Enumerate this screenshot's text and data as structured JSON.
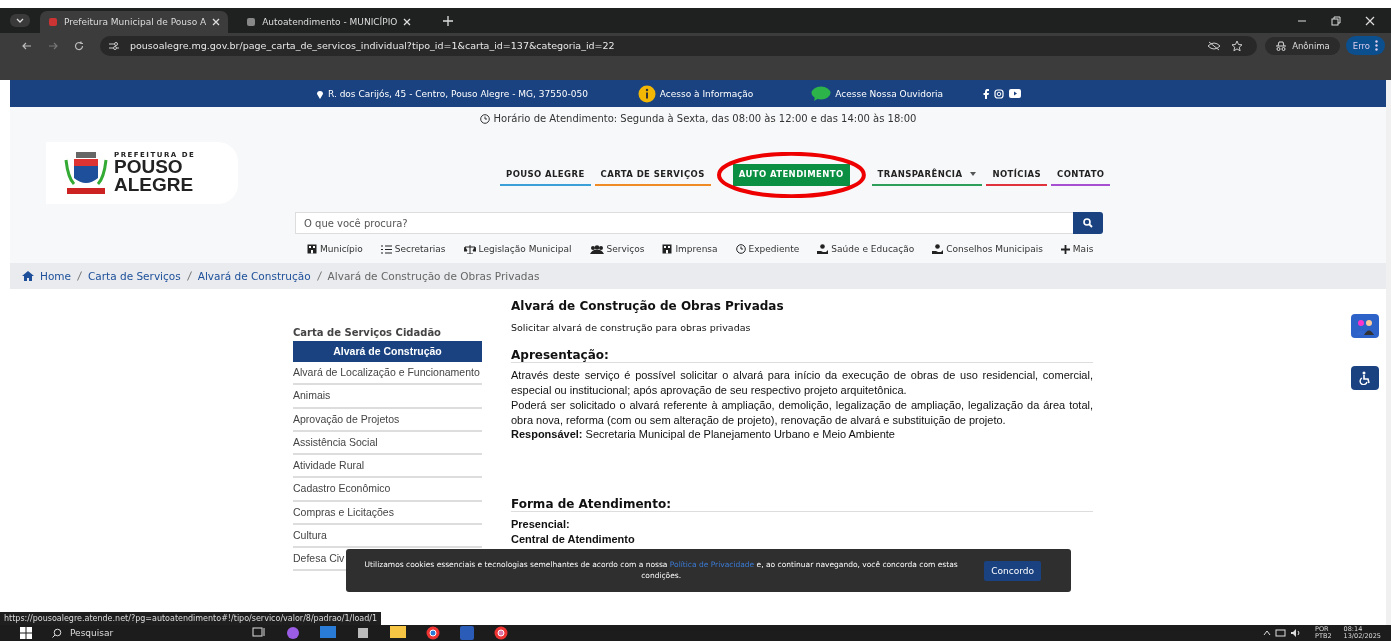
{
  "browser": {
    "tabs": [
      {
        "title": "Prefeitura Municipal de Pouso A",
        "selected": true
      },
      {
        "title": "Autoatendimento - MUNICÍPIO",
        "selected": false
      }
    ],
    "address": "pousoalegre.mg.gov.br/page_carta_de_servicos_individual?tipo_id=1&carta_id=137&categoria_id=22",
    "profile": "Anônima",
    "error_button": "Erro"
  },
  "top_bar": {
    "address": "R. dos Carijós, 45 - Centro, Pouso Alegre - MG, 37550-050",
    "access_info": "Acesso à Informação",
    "ombudsman": "Acesse Nossa Ouvidoria"
  },
  "hours": "Horário de Atendimento: Segunda à Sexta, das 08:00 às 12:00 e das 14:00 às 18:00",
  "logo": {
    "line_1": "PREFEITURA DE",
    "line_2": "POUSO",
    "line_3": "ALEGRE"
  },
  "nav": [
    {
      "label": "POUSO ALEGRE",
      "color": "#3ba0d8",
      "selected": false,
      "dropdown": false
    },
    {
      "label": "CARTA DE SERVIÇOS",
      "color": "#f08a24",
      "selected": false,
      "dropdown": false
    },
    {
      "label": "AUTO ATENDIMENTO",
      "color": "#0b8f43",
      "selected": true,
      "dropdown": false
    },
    {
      "label": "TRANSPARÊNCIA",
      "color": "#2e9e5a",
      "selected": false,
      "dropdown": true
    },
    {
      "label": "NOTÍCIAS",
      "color": "#e0323c",
      "selected": false,
      "dropdown": false
    },
    {
      "label": "CONTATO",
      "color": "#a64fd0",
      "selected": false,
      "dropdown": false
    }
  ],
  "search": {
    "placeholder": "O que você procura?"
  },
  "quick_links": [
    "Município",
    "Secretarias",
    "Legislação Municipal",
    "Serviços",
    "Imprensa",
    "Expediente",
    "Saúde e Educação",
    "Conselhos Municipais",
    "Mais"
  ],
  "breadcrumb": [
    "Home",
    "Carta de Serviços",
    "Alvará de Construção",
    "Alvará de Construção de Obras Privadas"
  ],
  "sidebar": {
    "title": "Carta de Serviços Cidadão",
    "items": [
      {
        "label": "Alvará de Construção",
        "selected": true
      },
      {
        "label": "Alvará de Localização e Funcionamento",
        "selected": false
      },
      {
        "label": "Animais",
        "selected": false
      },
      {
        "label": "Aprovação de Projetos",
        "selected": false
      },
      {
        "label": "Assistência Social",
        "selected": false
      },
      {
        "label": "Atividade Rural",
        "selected": false
      },
      {
        "label": "Cadastro Econômico",
        "selected": false
      },
      {
        "label": "Compras e Licitações",
        "selected": false
      },
      {
        "label": "Cultura",
        "selected": false
      },
      {
        "label": "Defesa Civ",
        "selected": false
      }
    ]
  },
  "content": {
    "title": "Alvará de Construção de Obras Privadas",
    "subtitle": "Solicitar alvará de construção para obras privadas",
    "sections": [
      {
        "heading": "Apresentação:",
        "paragraphs": [
          "Através deste serviço é possível solicitar o alvará para início da execução de obras de uso residencial, comercial, especial ou institucional; após aprovação de seu respectivo projeto arquitetônica.",
          "Poderá ser solicitado o alvará referente à ampliação, demolição, legalização de ampliação, legalização da área total, obra nova, reforma (com ou sem alteração de projeto), renovação de alvará e substituição de projeto.",
          "**Responsável:** Secretaria Municipal de Planejamento Urbano e Meio Ambiente"
        ]
      },
      {
        "heading": "Forma de Atendimento:",
        "paragraphs": [
          "**Presencial:**",
          "**Central de Atendimento**"
        ]
      }
    ]
  },
  "cookie_banner": {
    "text_before": "Utilizamos cookies essenciais e tecnologias semelhantes de acordo com a nossa",
    "link": "Política de Privacidade",
    "text_after": "e, ao continuar navegando, você concorda com estas condições.",
    "button": "Concordo"
  },
  "status_url": "https://pousoalegre.atende.net/?pg=autoatendimento#!/tipo/servico/valor/8/padrao/1/load/1",
  "taskbar": {
    "search": "Pesquisar",
    "language": "POR",
    "layout": "PTB2",
    "time": "08:14",
    "date": "13/02/2025"
  }
}
